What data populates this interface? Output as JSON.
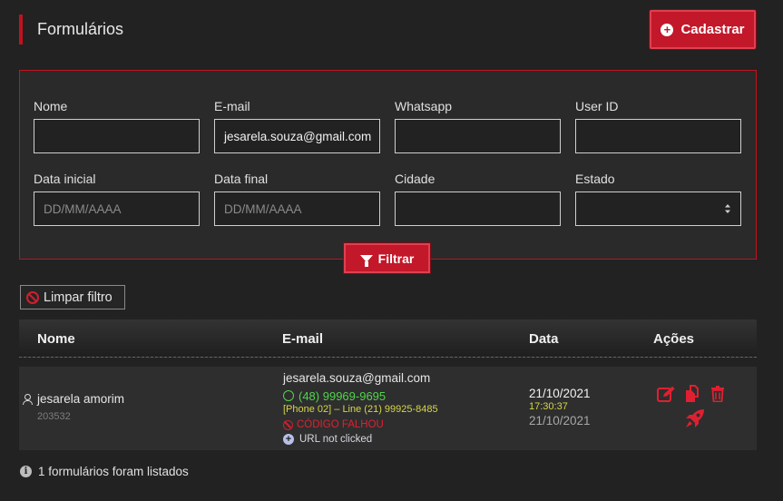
{
  "page": {
    "title": "Formulários"
  },
  "toolbar": {
    "register_label": "Cadastrar"
  },
  "filters": {
    "nome": {
      "label": "Nome",
      "value": ""
    },
    "email": {
      "label": "E-mail",
      "value": "jesarela.souza@gmail.com"
    },
    "whatsapp": {
      "label": "Whatsapp",
      "value": ""
    },
    "user_id": {
      "label": "User ID",
      "value": ""
    },
    "data_inicial": {
      "label": "Data inicial",
      "placeholder": "DD/MM/AAAA"
    },
    "data_final": {
      "label": "Data final",
      "placeholder": "DD/MM/AAAA"
    },
    "cidade": {
      "label": "Cidade",
      "value": ""
    },
    "estado": {
      "label": "Estado",
      "value": ""
    },
    "filter_label": "Filtrar",
    "clear_label": "Limpar filtro"
  },
  "table": {
    "columns": [
      "Nome",
      "E-mail",
      "Data",
      "Ações"
    ],
    "rows": [
      {
        "name": "jesarela amorim",
        "id": "203532",
        "email": "jesarela.souza@gmail.com",
        "phone": "(48) 99969-9695",
        "line": "[Phone 02] – Line (21) 99925-8485",
        "code_status": "CÓDIGO FALHOU",
        "url_status": "URL not clicked",
        "date": "21/10/2021",
        "time": "17:30:37",
        "date2": "21/10/2021"
      }
    ]
  },
  "footer": {
    "count_text": "1 formulários foram listados"
  },
  "colors": {
    "accent": "#c2182a",
    "whatsapp": "#52d44b",
    "warning": "#d6d64a",
    "error": "#e02030"
  },
  "icons": [
    "plus-circle-icon",
    "filter-icon",
    "ban-icon",
    "user-icon",
    "whatsapp-icon",
    "plus-circle-icon",
    "edit-icon",
    "copy-icon",
    "trash-icon",
    "rocket-icon",
    "info-icon"
  ]
}
